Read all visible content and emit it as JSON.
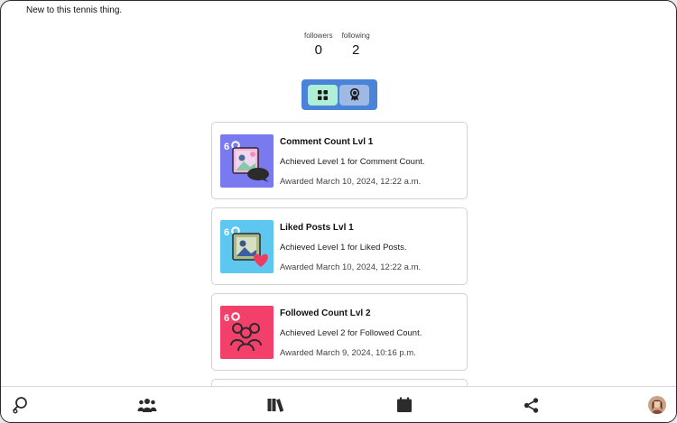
{
  "profile": {
    "bio": "New to this tennis thing.",
    "followers_label": "followers",
    "followers_count": "0",
    "following_label": "following",
    "following_count": "2"
  },
  "view_toggle": {
    "active": "grid-icon",
    "inactive": "award-icon"
  },
  "achievements": [
    {
      "title": "Comment Count Lvl 1",
      "description": "Achieved Level 1 for Comment Count.",
      "awarded": "Awarded March 10, 2024, 12:22 a.m.",
      "badge_color": "#7a7af0",
      "badge_text": "60"
    },
    {
      "title": "Liked Posts Lvl 1",
      "description": "Achieved Level 1 for Liked Posts.",
      "awarded": "Awarded March 10, 2024, 12:22 a.m.",
      "badge_color": "#5ec7f0",
      "badge_text": "60"
    },
    {
      "title": "Followed Count Lvl 2",
      "description": "Achieved Level 2 for Followed Count.",
      "awarded": "Awarded March 9, 2024, 10:16 p.m.",
      "badge_color": "#f2406a",
      "badge_text": "60"
    }
  ],
  "bottom_nav": [
    "search-icon",
    "community-icon",
    "library-icon",
    "calendar-icon",
    "share-icon",
    "profile-avatar"
  ]
}
